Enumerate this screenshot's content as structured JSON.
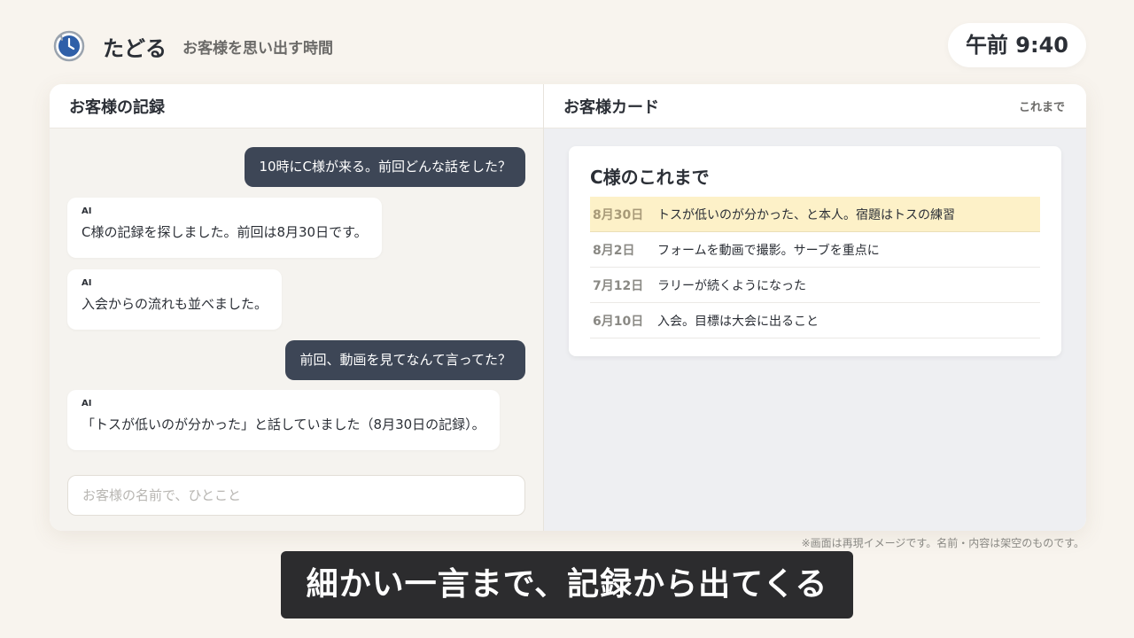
{
  "header": {
    "app_name": "たどる",
    "tagline": "お客様を思い出す時間",
    "clock": "午前 9:40"
  },
  "left_pane": {
    "title": "お客様の記録",
    "messages": [
      {
        "role": "user",
        "text": "10時にC様が来る。前回どんな話をした？"
      },
      {
        "role": "ai",
        "tag": "AI",
        "text": "C様の記録を探しました。前回は8月30日です。"
      },
      {
        "role": "ai",
        "tag": "AI",
        "text": "入会からの流れも並べました。"
      },
      {
        "role": "user",
        "text": "前回、動画を見てなんて言ってた？"
      },
      {
        "role": "ai",
        "tag": "AI",
        "text": "「トスが低いのが分かった」と話していました（8月30日の記録）。"
      }
    ],
    "input_placeholder": "お客様の名前で、ひとこと"
  },
  "right_pane": {
    "title": "お客様カード",
    "link": "これまで",
    "card": {
      "title": "C様のこれまで",
      "rows": [
        {
          "date": "8月30日",
          "text": "トスが低いのが分かった、と本人。宿題はトスの練習",
          "highlighted": true
        },
        {
          "date": "8月2日",
          "text": "フォームを動画で撮影。サーブを重点に",
          "highlighted": false
        },
        {
          "date": "7月12日",
          "text": "ラリーが続くようになった",
          "highlighted": false
        },
        {
          "date": "6月10日",
          "text": "入会。目標は大会に出ること",
          "highlighted": false
        }
      ]
    }
  },
  "disclaimer": "※画面は再現イメージです。名前・内容は架空のものです。",
  "caption": "細かい一言まで、記録から出てくる",
  "colors": {
    "background": "#f8f4ee",
    "user_bubble": "#3d4656",
    "highlight_row": "#fdf1c8",
    "caption_bg": "#2c2c2e",
    "logo_blue": "#2f5fa8"
  },
  "icons": {
    "logo": "clock-rewind-icon"
  }
}
